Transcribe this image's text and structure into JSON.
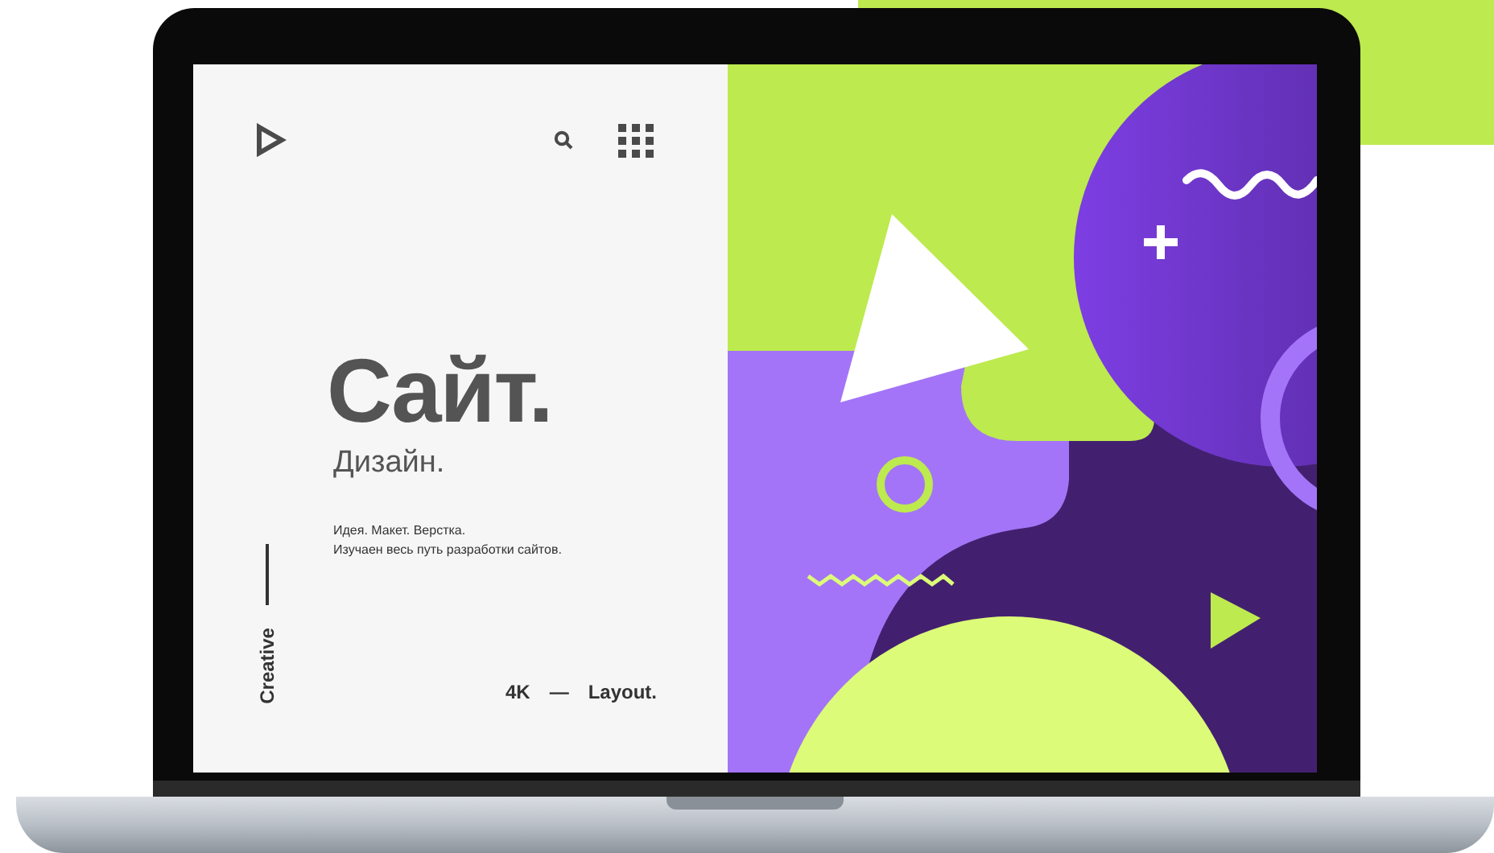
{
  "hero": {
    "title": "Сайт.",
    "subtitle": "Дизайн.",
    "description": [
      "Идея. Макет. Верстка.",
      "Изучаен весь путь разработки сайтов."
    ]
  },
  "side_label": "Creative",
  "footer": {
    "left": "4K",
    "separator": "—",
    "right": "Layout."
  }
}
